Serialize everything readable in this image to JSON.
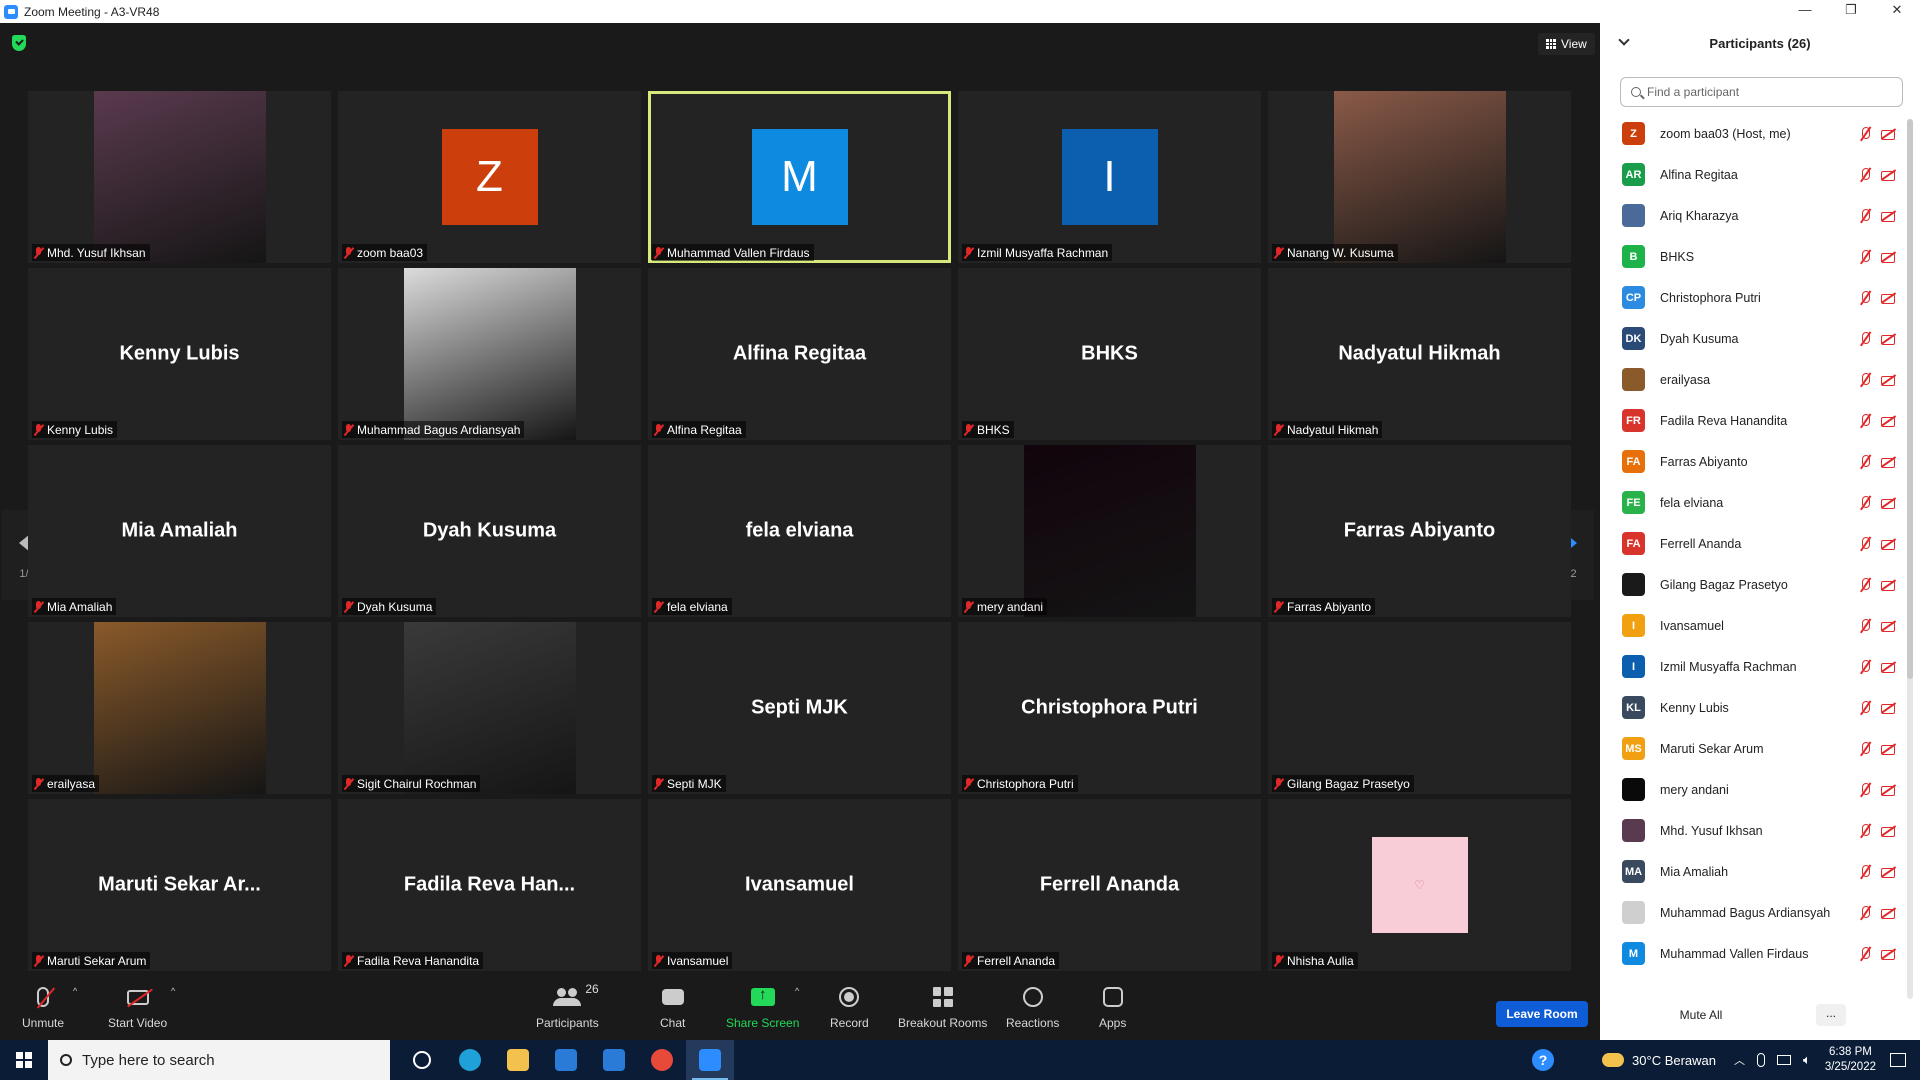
{
  "window": {
    "title": "Zoom Meeting - A3-VR48",
    "controls": [
      "—",
      "❐",
      "✕"
    ]
  },
  "meeting": {
    "view_label": "View",
    "page_indicator": "1/2",
    "tiles": [
      {
        "name": "Mhd. Yusuf Ikhsan",
        "kind": "photo",
        "color": "#5a3a4e"
      },
      {
        "name": "zoom baa03",
        "kind": "avatar",
        "letter": "Z",
        "color": "#cc3f0c"
      },
      {
        "name": "Muhammad Vallen Firdaus",
        "kind": "avatar",
        "letter": "M",
        "color": "#0e8ae0",
        "active": true
      },
      {
        "name": "Izmil Musyaffa Rachman",
        "kind": "avatar",
        "letter": "I",
        "color": "#0b5fae"
      },
      {
        "name": "Nanang W. Kusuma",
        "kind": "photo",
        "color": "#8a5a48"
      },
      {
        "name": "Kenny Lubis",
        "kind": "text",
        "display": "Kenny Lubis"
      },
      {
        "name": "Muhammad Bagus Ardiansyah",
        "kind": "photo",
        "color": "#dcdcdc"
      },
      {
        "name": "Alfina Regitaa",
        "kind": "text",
        "display": "Alfina Regitaa"
      },
      {
        "name": "BHKS",
        "kind": "text",
        "display": "BHKS"
      },
      {
        "name": "Nadyatul Hikmah",
        "kind": "text",
        "display": "Nadyatul Hikmah"
      },
      {
        "name": "Mia Amaliah",
        "kind": "text",
        "display": "Mia Amaliah"
      },
      {
        "name": "Dyah Kusuma",
        "kind": "text",
        "display": "Dyah Kusuma"
      },
      {
        "name": "fela elviana",
        "kind": "text",
        "display": "fela elviana"
      },
      {
        "name": "mery andani",
        "kind": "photo",
        "color": "#12040c"
      },
      {
        "name": "Farras Abiyanto",
        "kind": "text",
        "display": "Farras Abiyanto"
      },
      {
        "name": "erailyasa",
        "kind": "photo",
        "color": "#8a5a2a"
      },
      {
        "name": "Sigit Chairul Rochman",
        "kind": "photo",
        "color": "#3a3a3a"
      },
      {
        "name": "Septi MJK",
        "kind": "text",
        "display": "Septi MJK"
      },
      {
        "name": "Christophora Putri",
        "kind": "text",
        "display": "Christophora Putri"
      },
      {
        "name": "Gilang Bagaz Prasetyo",
        "kind": "blank"
      },
      {
        "name": "Maruti Sekar Arum",
        "kind": "text",
        "display": "Maruti Sekar Ar..."
      },
      {
        "name": "Fadila Reva Hanandita",
        "kind": "text",
        "display": "Fadila Reva Han..."
      },
      {
        "name": "Ivansamuel",
        "kind": "text",
        "display": "Ivansamuel"
      },
      {
        "name": "Ferrell Ananda",
        "kind": "text",
        "display": "Ferrell Ananda"
      },
      {
        "name": "Nhisha Aulia",
        "kind": "pinkbox",
        "glyph": "♡",
        "color": "#f9cdd8"
      }
    ]
  },
  "toolbar": {
    "unmute": "Unmute",
    "start_video": "Start Video",
    "participants": "Participants",
    "participants_count": "26",
    "chat": "Chat",
    "share_screen": "Share Screen",
    "record": "Record",
    "breakout_rooms": "Breakout Rooms",
    "reactions": "Reactions",
    "apps": "Apps",
    "leave": "Leave Room",
    "caret": "^"
  },
  "panel": {
    "title": "Participants (26)",
    "search_placeholder": "Find a participant",
    "mute_all": "Mute All",
    "more": "...",
    "participants": [
      {
        "initials": "Z",
        "name": "zoom baa03 (Host, me)",
        "color": "#cc3f0c"
      },
      {
        "initials": "AR",
        "name": "Alfina Regitaa",
        "color": "#1a9d4a"
      },
      {
        "initials": "",
        "name": "Ariq Kharazya",
        "color": "#4a6a9a"
      },
      {
        "initials": "B",
        "name": "BHKS",
        "color": "#1eb24a"
      },
      {
        "initials": "CP",
        "name": "Christophora Putri",
        "color": "#2a8be0"
      },
      {
        "initials": "DK",
        "name": "Dyah Kusuma",
        "color": "#2a4a78"
      },
      {
        "initials": "",
        "name": "erailyasa",
        "color": "#8a5a2a"
      },
      {
        "initials": "FR",
        "name": "Fadila Reva Hanandita",
        "color": "#d9342b"
      },
      {
        "initials": "FA",
        "name": "Farras Abiyanto",
        "color": "#e8700a"
      },
      {
        "initials": "FE",
        "name": "fela elviana",
        "color": "#2ab24a"
      },
      {
        "initials": "FA",
        "name": "Ferrell Ananda",
        "color": "#d9342b"
      },
      {
        "initials": "",
        "name": "Gilang Bagaz Prasetyo",
        "color": "#1a1a1a"
      },
      {
        "initials": "I",
        "name": "Ivansamuel",
        "color": "#f0a010"
      },
      {
        "initials": "I",
        "name": "Izmil Musyaffa Rachman",
        "color": "#0b5fae"
      },
      {
        "initials": "KL",
        "name": "Kenny Lubis",
        "color": "#3a4a5e"
      },
      {
        "initials": "MS",
        "name": "Maruti Sekar Arum",
        "color": "#f0a010"
      },
      {
        "initials": "",
        "name": "mery andani",
        "color": "#0a0a0a"
      },
      {
        "initials": "",
        "name": "Mhd. Yusuf Ikhsan",
        "color": "#5a3a4e"
      },
      {
        "initials": "MA",
        "name": "Mia Amaliah",
        "color": "#3a4a5e"
      },
      {
        "initials": "",
        "name": "Muhammad Bagus Ardiansyah",
        "color": "#cfcfcf"
      },
      {
        "initials": "M",
        "name": "Muhammad Vallen Firdaus",
        "color": "#0e8ae0"
      }
    ]
  },
  "taskbar": {
    "search_placeholder": "Type here to search",
    "weather": "30°C  Berawan",
    "time": "6:38 PM",
    "date": "3/25/2022",
    "help": "?",
    "apps": [
      {
        "name": "task-view-icon",
        "color": "#0b1d36"
      },
      {
        "name": "edge-icon",
        "color": "#1fa0d8"
      },
      {
        "name": "file-explorer-icon",
        "color": "#f2c14e"
      },
      {
        "name": "store-icon",
        "color": "#2a7ad8"
      },
      {
        "name": "mail-icon",
        "color": "#2a7ad8"
      },
      {
        "name": "chrome-icon",
        "color": "#e84a3a"
      },
      {
        "name": "zoom-icon",
        "color": "#2d8cff"
      }
    ]
  }
}
